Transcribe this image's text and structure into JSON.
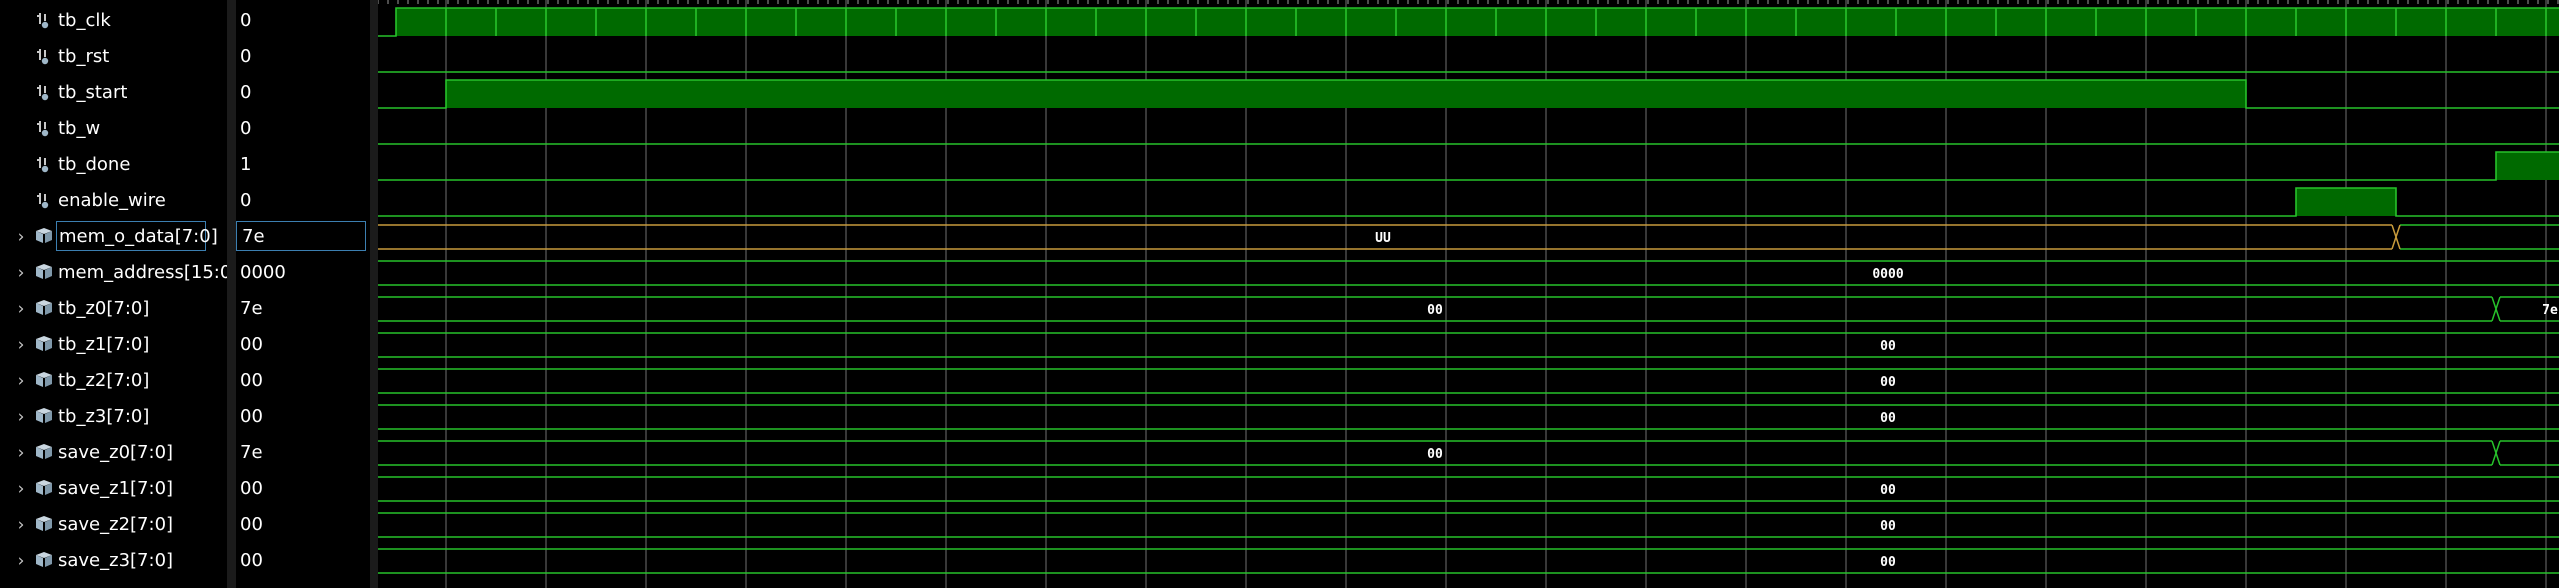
{
  "colors": {
    "wave_line": "#27c22b",
    "wave_fill": "#006a00",
    "grid": "#6f6f6f",
    "bus_label": "#ffffff",
    "transition_x": "#c89b3c",
    "selection": "#3c7fb1"
  },
  "signals": [
    {
      "name": "tb_clk",
      "value": "0",
      "kind": "bit",
      "icon": "logic-bit-icon"
    },
    {
      "name": "tb_rst",
      "value": "0",
      "kind": "bit",
      "icon": "logic-bit-icon"
    },
    {
      "name": "tb_start",
      "value": "0",
      "kind": "bit",
      "icon": "logic-bit-icon"
    },
    {
      "name": "tb_w",
      "value": "0",
      "kind": "bit",
      "icon": "logic-bit-icon"
    },
    {
      "name": "tb_done",
      "value": "1",
      "kind": "bit",
      "icon": "logic-bit-icon"
    },
    {
      "name": "enable_wire",
      "value": "0",
      "kind": "bit",
      "icon": "logic-bit-icon"
    },
    {
      "name": "mem_o_data[7:0]",
      "value": "7e",
      "kind": "bus",
      "icon": "bus-vector-icon",
      "selected": true,
      "segments": [
        "UU"
      ]
    },
    {
      "name": "mem_address[15:0]",
      "value": "0000",
      "kind": "bus",
      "icon": "bus-vector-icon",
      "segments": [
        "0000"
      ]
    },
    {
      "name": "tb_z0[7:0]",
      "value": "7e",
      "kind": "bus",
      "icon": "bus-vector-icon",
      "segments": [
        "00",
        "7e"
      ]
    },
    {
      "name": "tb_z1[7:0]",
      "value": "00",
      "kind": "bus",
      "icon": "bus-vector-icon",
      "segments": [
        "00"
      ]
    },
    {
      "name": "tb_z2[7:0]",
      "value": "00",
      "kind": "bus",
      "icon": "bus-vector-icon",
      "segments": [
        "00"
      ]
    },
    {
      "name": "tb_z3[7:0]",
      "value": "00",
      "kind": "bus",
      "icon": "bus-vector-icon",
      "segments": [
        "00"
      ]
    },
    {
      "name": "save_z0[7:0]",
      "value": "7e",
      "kind": "bus",
      "icon": "bus-vector-icon",
      "segments": [
        "00"
      ]
    },
    {
      "name": "save_z1[7:0]",
      "value": "00",
      "kind": "bus",
      "icon": "bus-vector-icon",
      "segments": [
        "00"
      ]
    },
    {
      "name": "save_z2[7:0]",
      "value": "00",
      "kind": "bus",
      "icon": "bus-vector-icon",
      "segments": [
        "00"
      ]
    },
    {
      "name": "save_z3[7:0]",
      "value": "00",
      "kind": "bus",
      "icon": "bus-vector-icon",
      "segments": [
        "00"
      ]
    }
  ]
}
